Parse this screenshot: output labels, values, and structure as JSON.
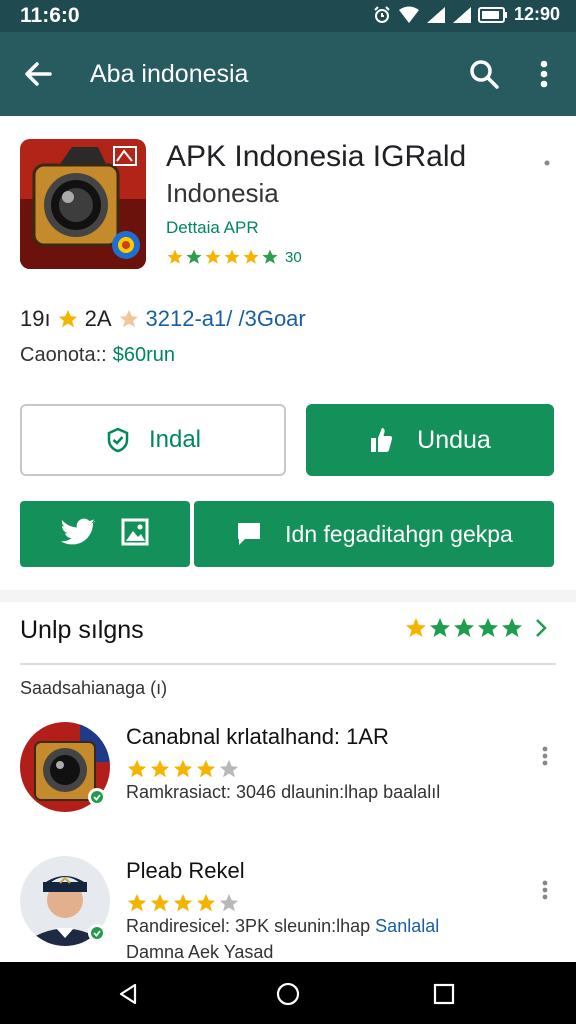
{
  "status_bar": {
    "time": "11:6:0",
    "right_text": "12:90",
    "icons": [
      "alarm-icon",
      "wifi-icon",
      "signal-icon",
      "battery-icon"
    ]
  },
  "app_bar": {
    "back_icon": "arrow-left-icon",
    "title": "Aba indonesia",
    "search_icon": "search-icon",
    "more_icon": "more-vert-icon"
  },
  "app_header": {
    "name": "APK Indonesia IGRald",
    "subtitle": "Indonesia",
    "developer": "Dettaia APR",
    "rating_stars": 4.5,
    "rating_count": "30"
  },
  "meta": {
    "part_a": "19ı",
    "part_b": "2A",
    "part_c": "3212-a1/ /3Goar",
    "price_label": "Caonota::",
    "price_value": "$60run"
  },
  "actions": {
    "install_label": "Indal",
    "download_label": "Undua",
    "feedback_label": "Idn fegaditahgn gekpa"
  },
  "reviews_section": {
    "title": "Unlp sılgns",
    "stars": 4.5,
    "subtitle": "Saadsahianaga (ı)"
  },
  "reviews": [
    {
      "name": "Canabnal krlatalhand: 1AR",
      "stars": 4,
      "text": "Ramkrasiact: 3046 dlaunin:lhap baalalıl",
      "text_plain": "",
      "text_accent": "",
      "text2": ""
    },
    {
      "name": "Pleab Rekel",
      "stars": 4,
      "text": "",
      "text_plain": "Randiresicel: 3PK sleunin:lhap",
      "text_accent": "Sanlalal",
      "text2": "Damna Aek Yasad"
    }
  ],
  "colors": {
    "app_bar": "#275b60",
    "status_bar": "#1f4a4f",
    "primary_green": "#14915a",
    "star": "#f5b400",
    "link_blue": "#1a5fa0"
  }
}
